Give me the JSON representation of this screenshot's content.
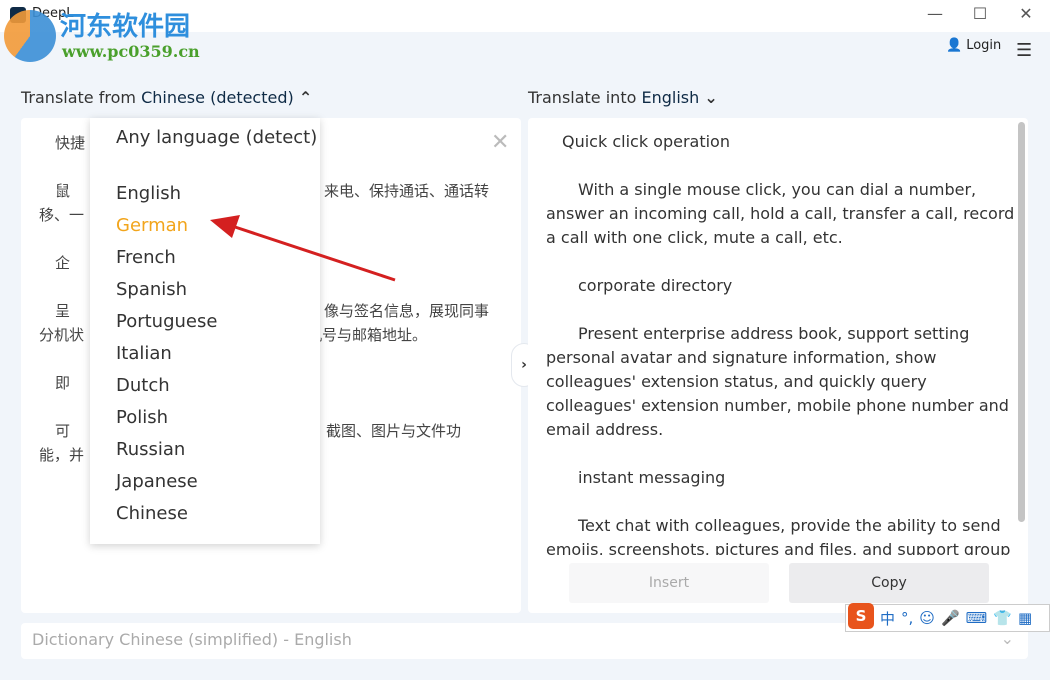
{
  "window": {
    "title": "DeepL",
    "minimize": "—",
    "maximize": "☐",
    "close": "✕"
  },
  "watermark": {
    "name": "河东软件园",
    "url": "www.pc0359.cn"
  },
  "header": {
    "login": "Login",
    "menu_icon": "☰"
  },
  "source": {
    "label_prefix": "Translate from",
    "language": "Chinese (detected)",
    "chevron": "⌃",
    "fragments": [
      {
        "left": "快捷",
        "right": ""
      },
      {
        "left": "鼠",
        "right": "来电、保持通话、通话转"
      },
      {
        "left": "移、一",
        "right": ""
      },
      {
        "left": "企",
        "right": ""
      },
      {
        "left": "呈",
        "right": "像与签名信息，展现同事"
      },
      {
        "left": "分机状",
        "right": "机号与邮箱地址。"
      },
      {
        "left": "即",
        "right": ""
      },
      {
        "left": "可",
        "right": "截图、图片与文件功"
      },
      {
        "left": "能，并",
        "right": ""
      }
    ]
  },
  "target": {
    "label_prefix": "Translate into",
    "language": "English",
    "paragraphs": [
      "Quick click operation",
      "With a single mouse click, you can dial a number, answer an incoming call, hold a call, transfer a call, record a call with one click, mute a call, etc.",
      "corporate directory",
      "Present enterprise address book, support setting personal avatar and signature information, show colleagues' extension status, and quickly query colleagues' extension number, mobile phone number and email address.",
      "instant messaging",
      "Text chat with colleagues, provide the ability to send emojis, screenshots, pictures and files, and support group chat creation"
    ],
    "insert": "Insert",
    "copy": "Copy"
  },
  "dropdown": {
    "options": [
      "Any language (detect)",
      "English",
      "German",
      "French",
      "Spanish",
      "Portuguese",
      "Italian",
      "Dutch",
      "Polish",
      "Russian",
      "Japanese",
      "Chinese"
    ],
    "highlighted": "German",
    "highlight_color": "#f2a51c"
  },
  "dictionary": {
    "label": "Dictionary Chinese (simplified) - English"
  },
  "ime": {
    "logo": "S",
    "mode": "中",
    "punct": "°,",
    "emoji": "☺",
    "mic": "🎤",
    "keyboard": "⌨",
    "skin": "👕",
    "grid": "▦"
  },
  "colors": {
    "accent": "#0f2b46",
    "annotation_arrow": "#d42020"
  }
}
